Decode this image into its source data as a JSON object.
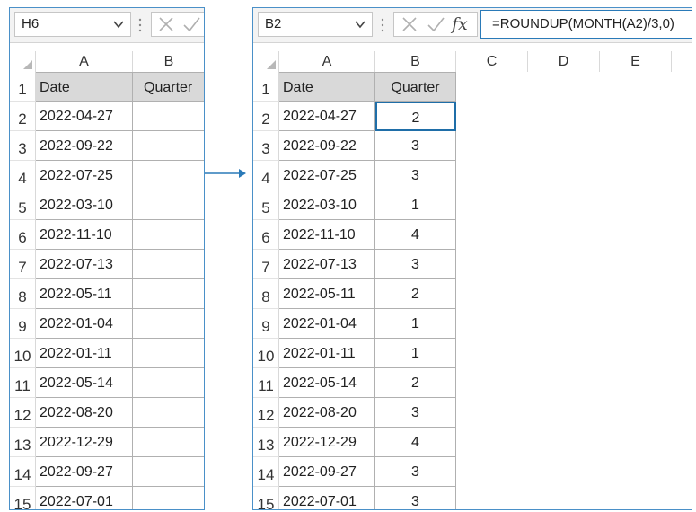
{
  "left": {
    "namebox": "H6",
    "columns": [
      "A",
      "B"
    ],
    "header": {
      "date": "Date",
      "quarter": "Quarter"
    },
    "header_row_num": "1",
    "rows": [
      {
        "num": "2",
        "date": "2022-04-27",
        "quarter": ""
      },
      {
        "num": "3",
        "date": "2022-09-22",
        "quarter": ""
      },
      {
        "num": "4",
        "date": "2022-07-25",
        "quarter": ""
      },
      {
        "num": "5",
        "date": "2022-03-10",
        "quarter": ""
      },
      {
        "num": "6",
        "date": "2022-11-10",
        "quarter": ""
      },
      {
        "num": "7",
        "date": "2022-07-13",
        "quarter": ""
      },
      {
        "num": "8",
        "date": "2022-05-11",
        "quarter": ""
      },
      {
        "num": "9",
        "date": "2022-01-04",
        "quarter": ""
      },
      {
        "num": "10",
        "date": "2022-01-11",
        "quarter": ""
      },
      {
        "num": "11",
        "date": "2022-05-14",
        "quarter": ""
      },
      {
        "num": "12",
        "date": "2022-08-20",
        "quarter": ""
      },
      {
        "num": "13",
        "date": "2022-12-29",
        "quarter": ""
      },
      {
        "num": "14",
        "date": "2022-09-27",
        "quarter": ""
      },
      {
        "num": "15",
        "date": "2022-07-01",
        "quarter": ""
      }
    ]
  },
  "right": {
    "namebox": "B2",
    "formula": "=ROUNDUP(MONTH(A2)/3,0)",
    "fx_label": "fx",
    "columns": [
      "A",
      "B",
      "C",
      "D",
      "E"
    ],
    "header": {
      "date": "Date",
      "quarter": "Quarter"
    },
    "header_row_num": "1",
    "rows": [
      {
        "num": "2",
        "date": "2022-04-27",
        "quarter": "2"
      },
      {
        "num": "3",
        "date": "2022-09-22",
        "quarter": "3"
      },
      {
        "num": "4",
        "date": "2022-07-25",
        "quarter": "3"
      },
      {
        "num": "5",
        "date": "2022-03-10",
        "quarter": "1"
      },
      {
        "num": "6",
        "date": "2022-11-10",
        "quarter": "4"
      },
      {
        "num": "7",
        "date": "2022-07-13",
        "quarter": "3"
      },
      {
        "num": "8",
        "date": "2022-05-11",
        "quarter": "2"
      },
      {
        "num": "9",
        "date": "2022-01-04",
        "quarter": "1"
      },
      {
        "num": "10",
        "date": "2022-01-11",
        "quarter": "1"
      },
      {
        "num": "11",
        "date": "2022-05-14",
        "quarter": "2"
      },
      {
        "num": "12",
        "date": "2022-08-20",
        "quarter": "3"
      },
      {
        "num": "13",
        "date": "2022-12-29",
        "quarter": "4"
      },
      {
        "num": "14",
        "date": "2022-09-27",
        "quarter": "3"
      },
      {
        "num": "15",
        "date": "2022-07-01",
        "quarter": "3"
      }
    ]
  },
  "colors": {
    "accent": "#2a7ab8",
    "header_fill": "#d9d9d9",
    "arrow": "#2a7ab8"
  },
  "icons": {
    "cancel": "x-icon",
    "confirm": "check-icon",
    "function": "fx-icon",
    "dropdown": "chevron-down-icon"
  }
}
